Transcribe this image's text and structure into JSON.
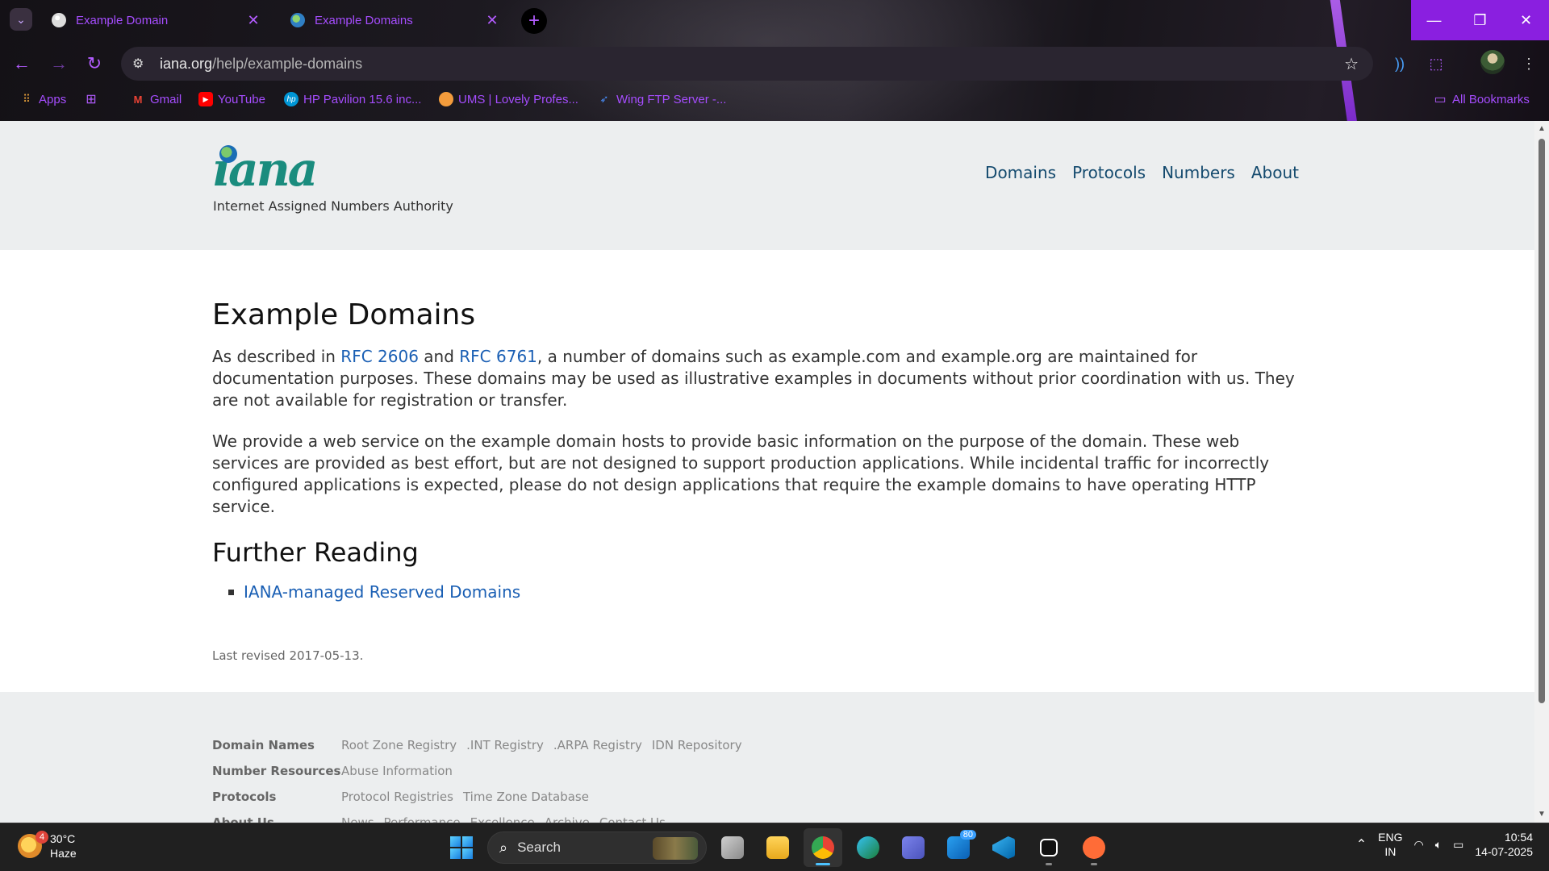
{
  "browser": {
    "tabs": [
      {
        "title": "Example Domain",
        "favicon": "globe-icon"
      },
      {
        "title": "Example Domains",
        "favicon": "iana-icon"
      }
    ],
    "address": {
      "host": "iana.org",
      "path": "/help/example-domains"
    },
    "bookmarks": [
      {
        "label": "Apps",
        "icon": "apps-grid-icon"
      },
      {
        "label": "Gmail",
        "icon": "gmail-icon"
      },
      {
        "label": "YouTube",
        "icon": "youtube-icon"
      },
      {
        "label": "HP Pavilion 15.6 inc...",
        "icon": "hp-icon"
      },
      {
        "label": "UMS | Lovely Profes...",
        "icon": "ums-icon"
      },
      {
        "label": "Wing FTP Server -...",
        "icon": "wing-icon"
      }
    ],
    "all_bookmarks": "All Bookmarks",
    "accent": "#a64dff"
  },
  "site": {
    "logo_word": "iana",
    "logo_sub": "Internet Assigned Numbers Authority",
    "nav": [
      "Domains",
      "Protocols",
      "Numbers",
      "About"
    ]
  },
  "content": {
    "title": "Example Domains",
    "p1": {
      "pre": "As described in ",
      "link1": "RFC 2606",
      "mid": " and ",
      "link2": "RFC 6761",
      "post": ", a number of domains such as example.com and example.org are maintained for documentation purposes. These domains may be used as illustrative examples in documents without prior coordination with us. They are not available for registration or transfer."
    },
    "p2": "We provide a web service on the example domain hosts to provide basic information on the purpose of the domain. These web services are provided as best effort, but are not designed to support production applications. While incidental traffic for incorrectly configured applications is expected, please do not design applications that require the example domains to have operating HTTP service.",
    "further_title": "Further Reading",
    "further_links": [
      "IANA-managed Reserved Domains"
    ],
    "revised": "Last revised 2017-05-13."
  },
  "footer": {
    "rows": [
      {
        "head": "Domain Names",
        "links": [
          "Root Zone Registry",
          ".INT Registry",
          ".ARPA Registry",
          "IDN Repository"
        ]
      },
      {
        "head": "Number Resources",
        "links": [
          "Abuse Information"
        ]
      },
      {
        "head": "Protocols",
        "links": [
          "Protocol Registries",
          "Time Zone Database"
        ]
      },
      {
        "head": "About Us",
        "links": [
          "News",
          "Performance",
          "Excellence",
          "Archive",
          "Contact Us"
        ]
      }
    ]
  },
  "taskbar": {
    "weather": {
      "temp": "30°C",
      "cond": "Haze",
      "badge": "4"
    },
    "search": "Search",
    "store_badge": "80",
    "lang": {
      "l1": "ENG",
      "l2": "IN"
    },
    "time": "10:54",
    "date": "14-07-2025"
  }
}
